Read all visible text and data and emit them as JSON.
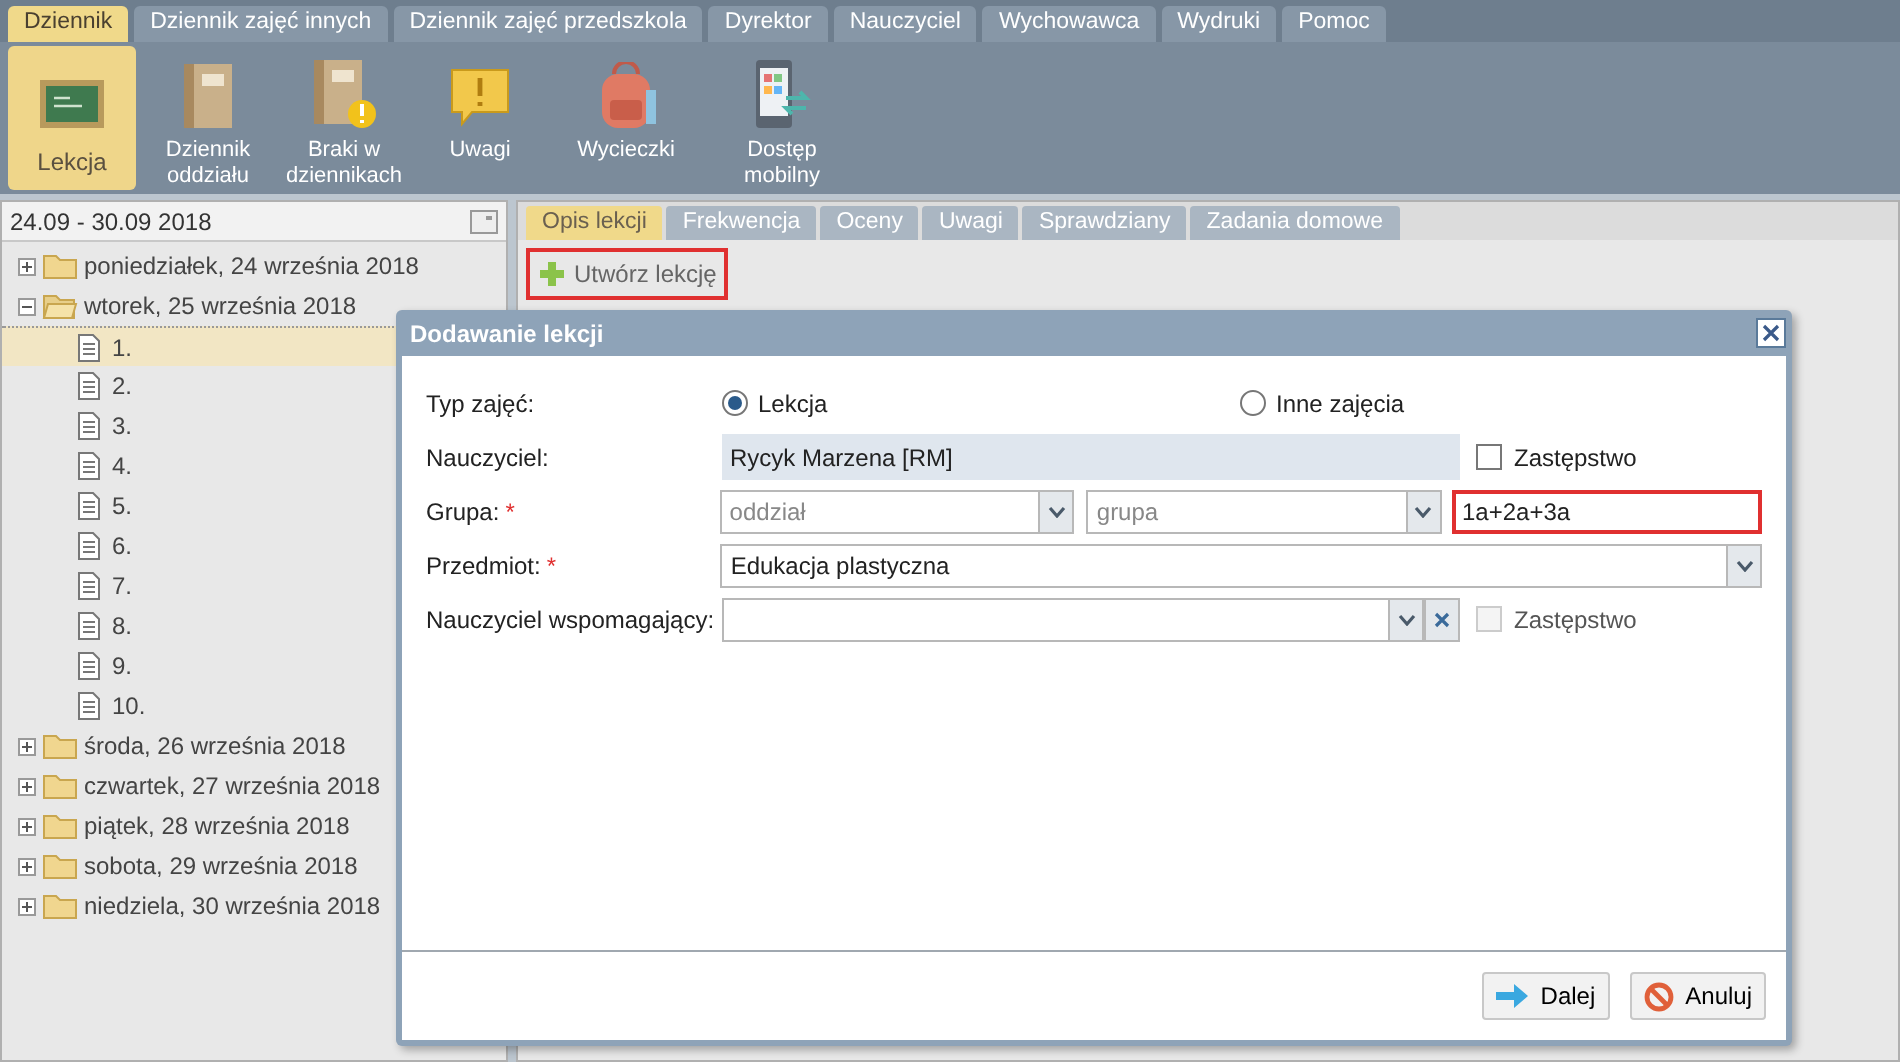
{
  "menu_tabs": [
    {
      "label": "Dziennik",
      "selected": true
    },
    {
      "label": "Dziennik zajęć innych",
      "selected": false
    },
    {
      "label": "Dziennik zajęć przedszkola",
      "selected": false
    },
    {
      "label": "Dyrektor",
      "selected": false
    },
    {
      "label": "Nauczyciel",
      "selected": false
    },
    {
      "label": "Wychowawca",
      "selected": false
    },
    {
      "label": "Wydruki",
      "selected": false
    },
    {
      "label": "Pomoc",
      "selected": false
    }
  ],
  "toolbar": [
    {
      "kind": "board",
      "label": "Lekcja",
      "selected": true
    },
    {
      "kind": "book",
      "label": "Dziennik oddziału",
      "selected": false
    },
    {
      "kind": "book-warning",
      "label": "Braki w dziennikach",
      "selected": false
    },
    {
      "kind": "note",
      "label": "Uwagi",
      "selected": false
    },
    {
      "kind": "backpack",
      "label": "Wycieczki",
      "selected": false
    },
    {
      "kind": "phone",
      "label": "Dostęp mobilny",
      "selected": false
    }
  ],
  "week_range": "24.09 - 30.09 2018",
  "tree": [
    {
      "label": "poniedziałek, 24 września 2018",
      "expanded": false
    },
    {
      "label": "wtorek, 25 września 2018",
      "expanded": true,
      "children": [
        {
          "label": "1.",
          "selected": true
        },
        {
          "label": "2.",
          "selected": false
        },
        {
          "label": "3.",
          "selected": false
        },
        {
          "label": "4.",
          "selected": false
        },
        {
          "label": "5.",
          "selected": false
        },
        {
          "label": "6.",
          "selected": false
        },
        {
          "label": "7.",
          "selected": false
        },
        {
          "label": "8.",
          "selected": false
        },
        {
          "label": "9.",
          "selected": false
        },
        {
          "label": "10.",
          "selected": false
        }
      ]
    },
    {
      "label": "środa, 26 września 2018",
      "expanded": false
    },
    {
      "label": "czwartek, 27 września 2018",
      "expanded": false
    },
    {
      "label": "piątek, 28 września 2018",
      "expanded": false
    },
    {
      "label": "sobota, 29 września 2018",
      "expanded": false
    },
    {
      "label": "niedziela, 30 września 2018",
      "expanded": false
    }
  ],
  "lesson_tabs": [
    {
      "label": "Opis lekcji",
      "selected": true
    },
    {
      "label": "Frekwencja",
      "selected": false
    },
    {
      "label": "Oceny",
      "selected": false
    },
    {
      "label": "Uwagi",
      "selected": false
    },
    {
      "label": "Sprawdziany",
      "selected": false
    },
    {
      "label": "Zadania domowe",
      "selected": false
    }
  ],
  "create_button": "Utwórz lekcję",
  "dialog": {
    "title": "Dodawanie lekcji",
    "type_label": "Typ zajęć:",
    "type_options": [
      {
        "label": "Lekcja",
        "selected": true
      },
      {
        "label": "Inne zajęcia",
        "selected": false
      }
    ],
    "teacher_label": "Nauczyciel:",
    "teacher_value": "Rycyk Marzena [RM]",
    "teacher_substitute": {
      "label": "Zastępstwo",
      "checked": false,
      "disabled": false
    },
    "group_label": "Grupa:",
    "group_required": "*",
    "class_placeholder": "oddział",
    "group_placeholder": "grupa",
    "group_value": "1a+2a+3a",
    "subject_label": "Przedmiot:",
    "subject_required": "*",
    "subject_value": "Edukacja plastyczna",
    "assistant_label": "Nauczyciel wspomagający:",
    "assistant_substitute": {
      "label": "Zastępstwo",
      "checked": false,
      "disabled": true
    },
    "next_button": "Dalej",
    "cancel_button": "Anuluj"
  }
}
